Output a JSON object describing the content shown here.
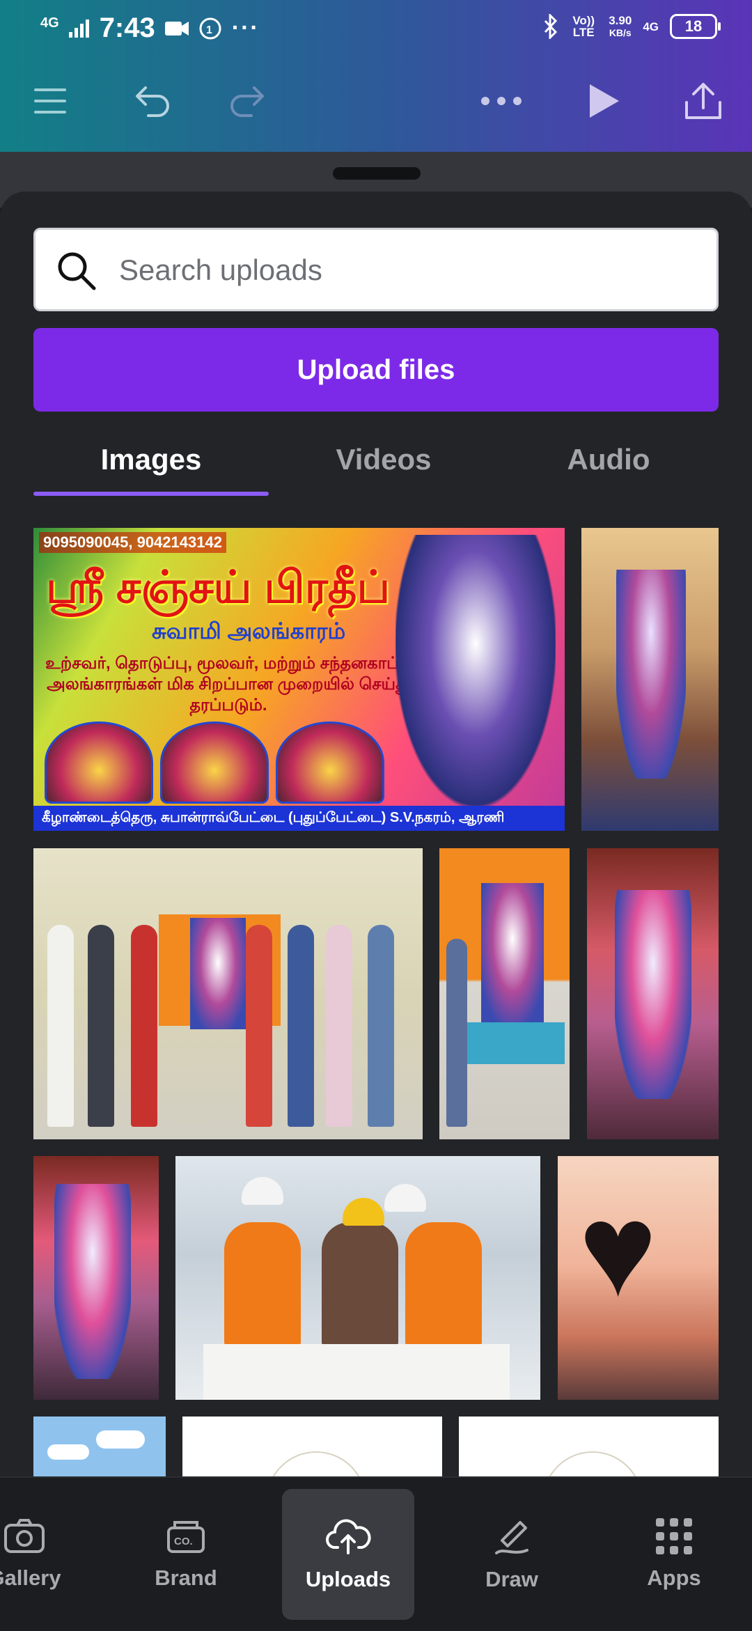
{
  "status_bar": {
    "network_top": "4G",
    "time": "7:43",
    "volte": "Vo)) LTE",
    "speed": "3.90",
    "speed_unit": "KB/s",
    "network_right": "4G",
    "battery": "18"
  },
  "toolbar": {
    "menu_icon": "menu-icon",
    "undo_icon": "undo-icon",
    "redo_icon": "redo-icon",
    "more_icon": "more-icon",
    "play_icon": "play-icon",
    "share_icon": "share-icon"
  },
  "search": {
    "placeholder": "Search uploads"
  },
  "upload": {
    "label": "Upload files"
  },
  "tabs": [
    {
      "label": "Images",
      "active": true
    },
    {
      "label": "Videos",
      "active": false
    },
    {
      "label": "Audio",
      "active": false
    }
  ],
  "banner": {
    "phone": "9095090045, 9042143142",
    "title": "ஸ்ரீ சஞ்சய் பிரதீப்",
    "subtitle": "சுவாமி அலங்காரம்",
    "body": "உற்சவர், தொடுப்பு, மூலவர், மற்றும் சந்தனகாப்பு அலங்காரங்கள் மிக சிறப்பான முறையில் செய்து தரப்படும்.",
    "footer": "கீழாண்டைத்தெரு, சுபான்ராவ்பேட்டை (புதுப்பேட்டை) S.V.நகரம், ஆரணி"
  },
  "colors": {
    "accent": "#7d2ae8",
    "tab_underline": "#8b5cf6",
    "sheet_bg": "#232428",
    "topbar_start": "#127f86",
    "topbar_end": "#5a34b8"
  },
  "bottom_nav": [
    {
      "label": "Gallery",
      "icon": "camera-icon",
      "active": false
    },
    {
      "label": "Brand",
      "icon": "brand-icon",
      "active": false
    },
    {
      "label": "Uploads",
      "icon": "cloud-upload-icon",
      "active": true
    },
    {
      "label": "Draw",
      "icon": "draw-icon",
      "active": false
    },
    {
      "label": "Apps",
      "icon": "apps-grid-icon",
      "active": false
    }
  ]
}
